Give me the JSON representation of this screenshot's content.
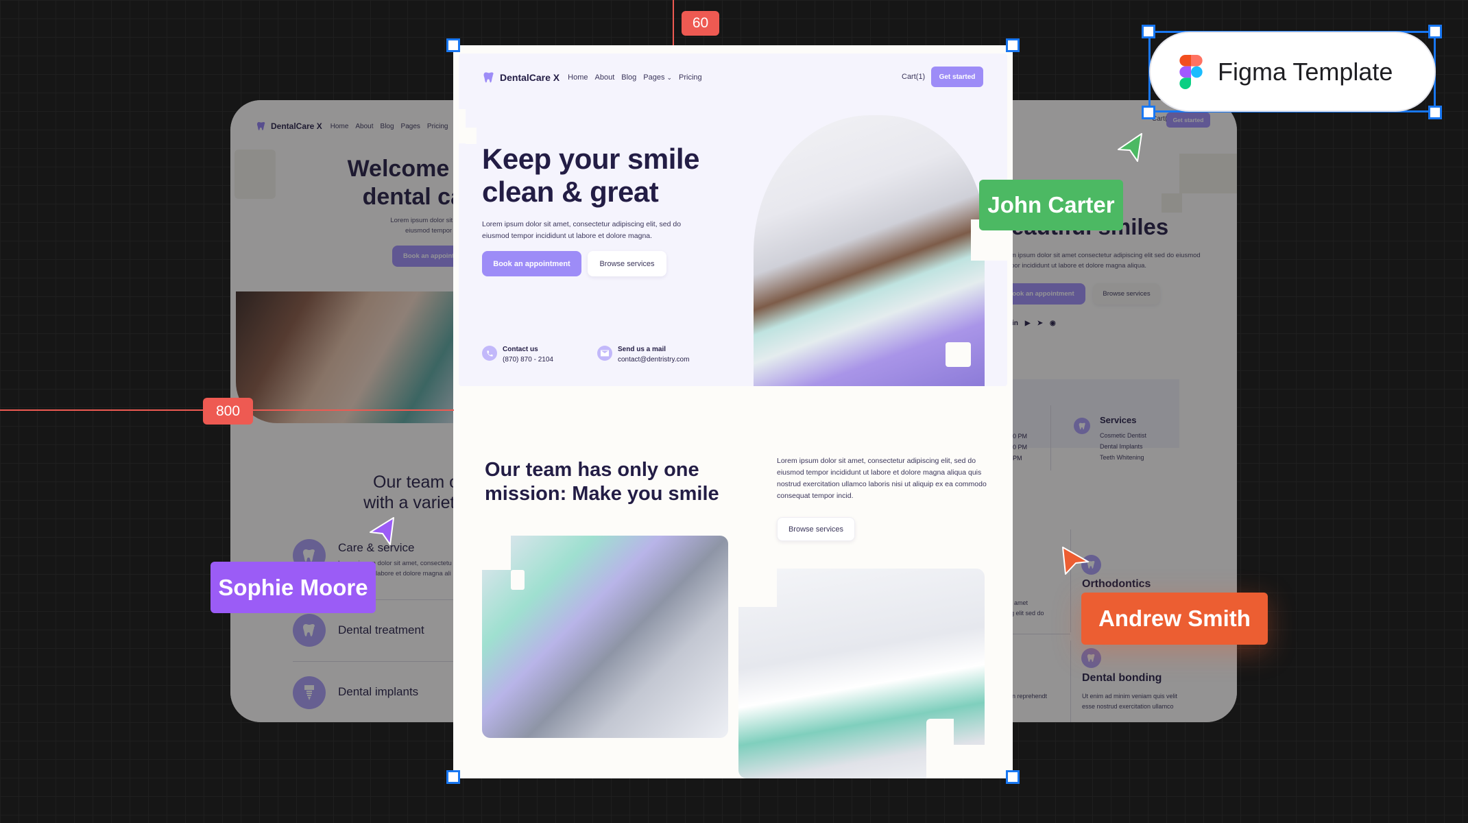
{
  "brand": "DentalCare X",
  "nav": {
    "items": [
      "Home",
      "About",
      "Blog",
      "Pages",
      "Pricing"
    ],
    "cart": "Cart(1)",
    "cta": "Get started"
  },
  "hero": {
    "title_line1": "Keep your smile",
    "title_line2": "clean & great",
    "text": "Lorem ipsum dolor sit amet, consectetur adipiscing elit, sed do eiusmod tempor incididunt ut labore et dolore magna.",
    "primary_btn": "Book an appointment",
    "secondary_btn": "Browse services",
    "contact": {
      "label": "Contact us",
      "value": "(870) 870 - 2104"
    },
    "mail": {
      "label": "Send us a mail",
      "value": "contact@dentristry.com"
    }
  },
  "mission": {
    "title_line1": "Our team has only one",
    "title_line2": "mission: Make you smile",
    "text": "Lorem ipsum dolor sit amet, consectetur adipiscing elit, sed do eiusmod tempor incididunt ut labore et dolore magna aliqua quis nostrud exercitation ullamco laboris nisi ut aliquip ex ea commodo consequat tempor incid.",
    "button": "Browse services"
  },
  "left_preview": {
    "title_line1": "Welcome t",
    "title_line2": "dental ca",
    "text1": "Lorem ipsum dolor sit am",
    "text2": "eiusmod tempor inci",
    "button": "Book an appoint",
    "team_line1": "Our team of",
    "team_line2": "with a variety",
    "services": [
      {
        "title": "Care & service",
        "text1": "Lorem ipsum dolor sit amet, consectetu",
        "text2": "labore et dolore magna ali"
      },
      {
        "title": "Dental treatment"
      },
      {
        "title": "Dental implants"
      }
    ]
  },
  "right_preview": {
    "cart": "Cart(1)",
    "cta": "Get started",
    "title": "eautiful smiles",
    "text1": "m ipsum dolor sit amet consectetur adipiscing elit sed do eiusmod",
    "text2": "por incididunt ut labore et dolore magna aliqua.",
    "primary_btn": "ook an appointment",
    "secondary_btn": "Browse services",
    "hours": [
      "0 PM",
      "0 PM",
      "PM"
    ],
    "services_title": "Services",
    "services": [
      "Cosmetic Dentist",
      "Dental Implants",
      "Teeth Whitening"
    ],
    "partial1": "t amet",
    "partial2": "g elit sed do",
    "partial3": "in reprehendt",
    "ortho": "Orthodontics",
    "bonding": "Dental bonding",
    "bonding_text1": "Ut enim ad minim veniam quis velit",
    "bonding_text2": "esse nostrud exercitation ullamco"
  },
  "guides": {
    "top": "60",
    "left": "800"
  },
  "badge": "Figma Template",
  "collaborators": [
    {
      "name": "John Carter",
      "color": "#4cb963"
    },
    {
      "name": "Sophie Moore",
      "color": "#9b5cf6"
    },
    {
      "name": "Andrew Smith",
      "color": "#ec5e32"
    }
  ],
  "colors": {
    "accent": "#9d8cf7",
    "heading": "#231d45",
    "guide": "#ee5a52",
    "selection": "#1877f2"
  }
}
